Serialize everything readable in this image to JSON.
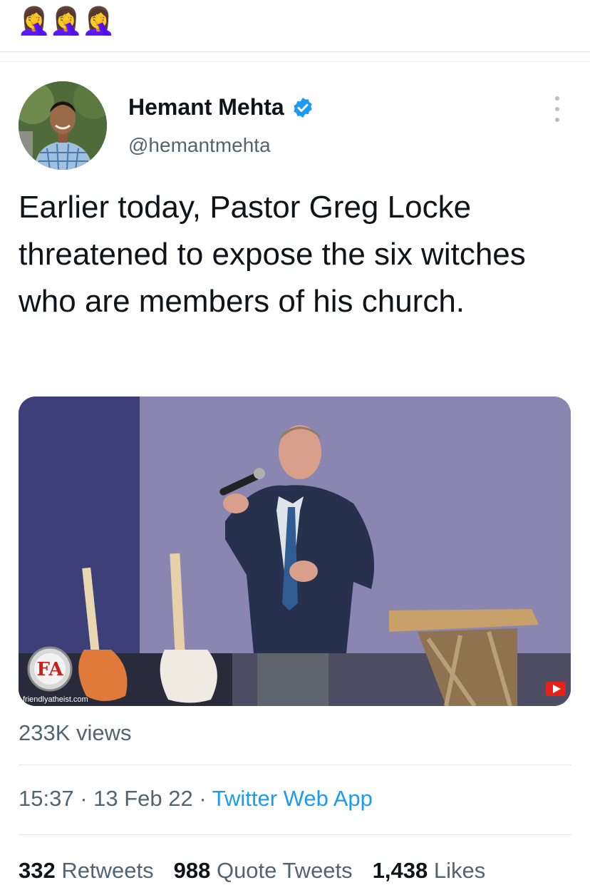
{
  "header": {
    "emojis": "🤦‍♀️🤦‍♀️🤦‍♀️"
  },
  "tweet": {
    "author_name": "Hemant Mehta",
    "handle": "@hemantmehta",
    "verified_icon": "verified-badge-icon",
    "more_icon": "more-options-icon",
    "text": "Earlier today, Pastor Greg Locke threatened to expose the six witches who are members of his church.",
    "media": {
      "watermark": "friendlyatheist.com",
      "logo_letters": "FA"
    },
    "views": "233K views",
    "time": "15:37",
    "sep1": " · ",
    "date": "13 Feb 22",
    "sep2": " · ",
    "source": "Twitter Web App",
    "stats": {
      "retweets_count": "332",
      "retweets_label": "Retweets",
      "quotes_count": "988",
      "quotes_label": "Quote Tweets",
      "likes_count": "1,438",
      "likes_label": "Likes"
    }
  },
  "colors": {
    "link": "#1d9bf0",
    "muted": "#536471",
    "text": "#0f1419"
  }
}
